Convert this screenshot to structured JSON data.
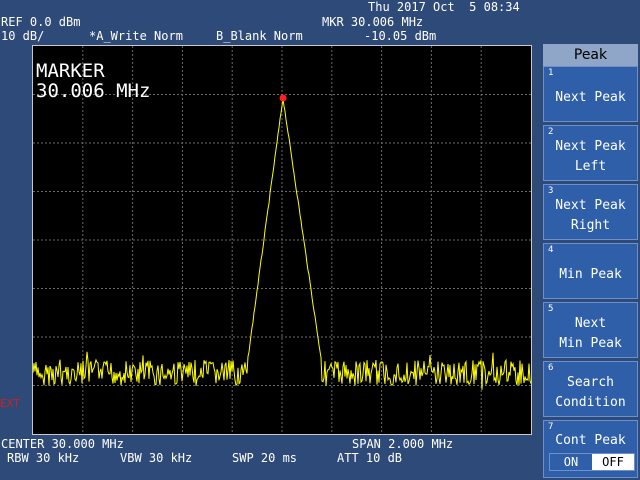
{
  "status": {
    "datetime": "Thu 2017 Oct  5 08:34",
    "ref": "REF 0.0 dBm",
    "scale": "10 dB/",
    "trace_a": "*A_Write Norm",
    "trace_b": "B_Blank Norm",
    "mkr_freq": "MKR 30.006 MHz",
    "mkr_level": "-10.05 dBm"
  },
  "display": {
    "marker_title": "MARKER",
    "marker_value": "30.006 MHz",
    "ext": "EXT"
  },
  "footer": {
    "center": "CENTER 30.000 MHz",
    "span": "SPAN 2.000 MHz",
    "rbw": "RBW 30 kHz",
    "vbw": "VBW 30 kHz",
    "swp": "SWP 20 ms",
    "att": "ATT 10 dB"
  },
  "softkeys": {
    "title": "Peak",
    "items": [
      {
        "num": "1",
        "line1": "Next Peak",
        "line2": ""
      },
      {
        "num": "2",
        "line1": "Next Peak",
        "line2": "Left"
      },
      {
        "num": "3",
        "line1": "Next Peak",
        "line2": "Right"
      },
      {
        "num": "4",
        "line1": "Min Peak",
        "line2": ""
      },
      {
        "num": "5",
        "line1": "Next",
        "line2": "Min Peak"
      },
      {
        "num": "6",
        "line1": "Search",
        "line2": "Condition"
      },
      {
        "num": "7",
        "line1": "Cont Peak",
        "line2": ""
      }
    ],
    "toggle_on": "ON",
    "toggle_off": "OFF"
  },
  "colors": {
    "trace": "#ffff00",
    "marker": "#ff2020",
    "grid": "#6a6a6a"
  }
}
